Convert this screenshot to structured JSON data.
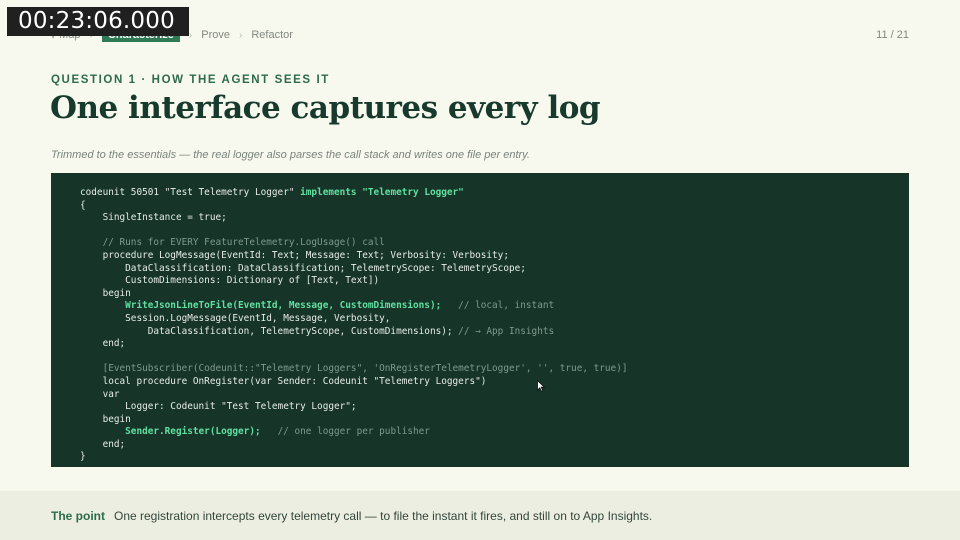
{
  "timer": "00:23:06.000",
  "nav": {
    "items": [
      {
        "label": "√ Map",
        "active": false
      },
      {
        "label": "Characterize",
        "active": true
      },
      {
        "label": "Prove",
        "active": false
      },
      {
        "label": "Refactor",
        "active": false
      }
    ],
    "separator": "›"
  },
  "page_number": "11 / 21",
  "eyebrow": "QUESTION 1 · HOW THE AGENT SEES IT",
  "title": "One interface captures every log",
  "subtitle": "Trimmed to the essentials — the real logger also parses the call stack and writes one file per entry.",
  "code_lines": [
    [
      {
        "t": "codeunit 50501 \"Test Telemetry Logger\" "
      },
      {
        "t": "implements",
        "c": "kw"
      },
      {
        "t": " "
      },
      {
        "t": "\"Telemetry Logger\"",
        "c": "kw"
      }
    ],
    [
      {
        "t": "{"
      }
    ],
    [
      {
        "t": "    SingleInstance = true;"
      }
    ],
    [
      {
        "t": ""
      }
    ],
    [
      {
        "t": "    // Runs for EVERY FeatureTelemetry.LogUsage() call",
        "c": "cm"
      }
    ],
    [
      {
        "t": "    procedure LogMessage(EventId: Text; Message: Text; Verbosity: Verbosity;"
      }
    ],
    [
      {
        "t": "        DataClassification: DataClassification; TelemetryScope: TelemetryScope;"
      }
    ],
    [
      {
        "t": "        CustomDimensions: Dictionary of [Text, Text])"
      }
    ],
    [
      {
        "t": "    begin"
      }
    ],
    [
      {
        "t": "        "
      },
      {
        "t": "WriteJsonLineToFile(EventId, Message, CustomDimensions);",
        "c": "hl"
      },
      {
        "t": "   "
      },
      {
        "t": "// local, instant",
        "c": "cm"
      }
    ],
    [
      {
        "t": "        Session.LogMessage(EventId, Message, Verbosity,"
      }
    ],
    [
      {
        "t": "            DataClassification, TelemetryScope, CustomDimensions); "
      },
      {
        "t": "// → App Insights",
        "c": "cm"
      }
    ],
    [
      {
        "t": "    end;"
      }
    ],
    [
      {
        "t": ""
      }
    ],
    [
      {
        "t": "    [EventSubscriber(Codeunit::\"Telemetry Loggers\", 'OnRegisterTelemetryLogger', '', true, true)]",
        "c": "attr"
      }
    ],
    [
      {
        "t": "    local procedure OnRegister(var Sender: Codeunit \"Telemetry Loggers\")"
      }
    ],
    [
      {
        "t": "    var"
      }
    ],
    [
      {
        "t": "        Logger: Codeunit \"Test Telemetry Logger\";"
      }
    ],
    [
      {
        "t": "    begin"
      }
    ],
    [
      {
        "t": "        "
      },
      {
        "t": "Sender.Register(Logger);",
        "c": "hl"
      },
      {
        "t": "   "
      },
      {
        "t": "// one logger per publisher",
        "c": "cm"
      }
    ],
    [
      {
        "t": "    end;"
      }
    ],
    [
      {
        "t": "}"
      }
    ]
  ],
  "footer": {
    "label": "The point",
    "text": "One registration intercepts every telemetry call — to file the instant it fires, and still on to App Insights."
  },
  "colors": {
    "accent": "#2f7a55",
    "code_background": "#163428",
    "code_highlight": "#5fe0a0"
  },
  "icons": {
    "cursor": "mouse-pointer-icon"
  }
}
